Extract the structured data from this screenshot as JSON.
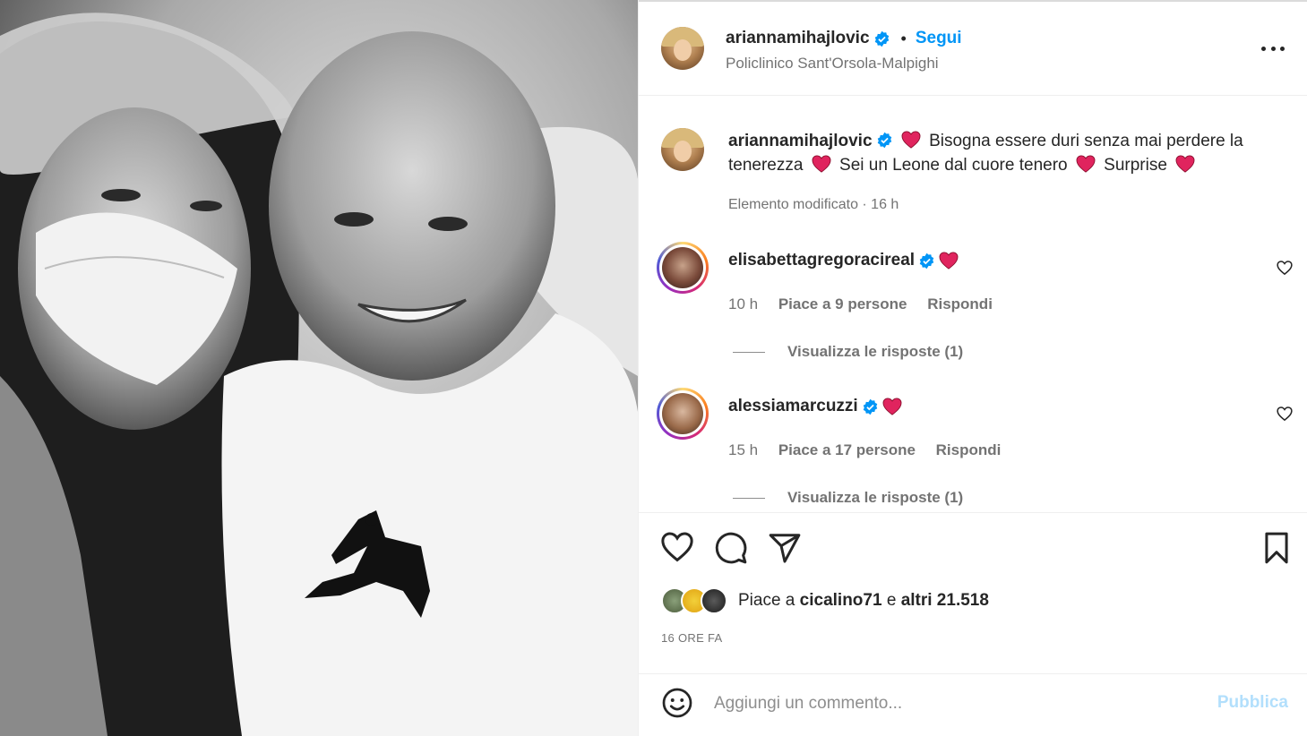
{
  "post": {
    "author": "ariannamihajlovic",
    "follow_label": "Segui",
    "separator": "•",
    "location": "Policlinico Sant'Orsola-Malpighi",
    "more_icon": "more-horizontal-icon"
  },
  "caption": {
    "author": "ariannamihajlovic",
    "part1": "Bisogna essere duri senza mai perdere la tenerezza",
    "part2": "Sei un Leone dal cuore tenero",
    "part3": "Surprise",
    "meta": "Elemento modificato · 16 h"
  },
  "comments": [
    {
      "username": "elisabettagregoracireal",
      "time": "10 h",
      "likes": "Piace a 9 persone",
      "reply": "Rispondi",
      "view_replies": "Visualizza le risposte (1)"
    },
    {
      "username": "alessiamarcuzzi",
      "time": "15 h",
      "likes": "Piace a 17 persone",
      "reply": "Rispondi",
      "view_replies": "Visualizza le risposte (1)"
    }
  ],
  "likes_line": {
    "prefix": "Piace a",
    "user": "cicalino71",
    "conj": "e",
    "others": "altri 21.518"
  },
  "time_ago": "16 ORE FA",
  "add_comment": {
    "placeholder": "Aggiungi un commento...",
    "publish_label": "Pubblica"
  },
  "colors": {
    "accent": "#0095f6",
    "heart_red": "#e0245e",
    "muted": "#737373",
    "publish_disabled": "#b2dffc"
  }
}
